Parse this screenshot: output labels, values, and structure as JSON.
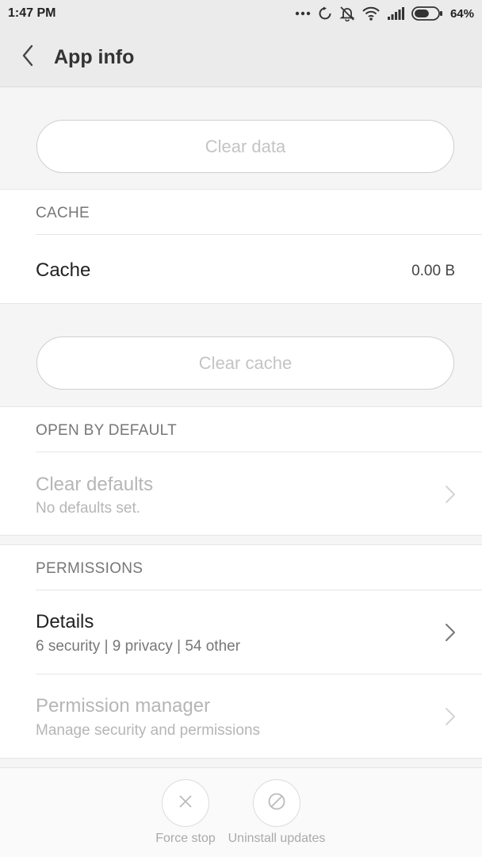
{
  "status_bar": {
    "time": "1:47 PM",
    "battery_percent": "64%",
    "battery_level": 0.64,
    "icons": [
      "more-dots-icon",
      "sync-icon",
      "notifications-off-icon",
      "wifi-icon",
      "signal-icon",
      "battery-icon"
    ]
  },
  "header": {
    "title": "App info",
    "back_icon": "chevron-left-icon"
  },
  "buttons": {
    "clear_data": "Clear data",
    "clear_cache": "Clear cache"
  },
  "cache_section": {
    "header": "CACHE",
    "row_title": "Cache",
    "row_value": "0.00 B"
  },
  "open_by_default": {
    "header": "OPEN BY DEFAULT",
    "row_title": "Clear defaults",
    "row_sub": "No defaults set."
  },
  "permissions": {
    "header": "PERMISSIONS",
    "details_title": "Details",
    "details_sub": "6 security | 9 privacy | 54 other",
    "manager_title": "Permission manager",
    "manager_sub": "Manage security and permissions"
  },
  "bottom_actions": {
    "force_stop": "Force stop",
    "uninstall_updates": "Uninstall updates"
  },
  "colors": {
    "header_bg": "#ebebeb",
    "disabled_text": "#b6b6b6",
    "secondary_text": "#777777"
  }
}
